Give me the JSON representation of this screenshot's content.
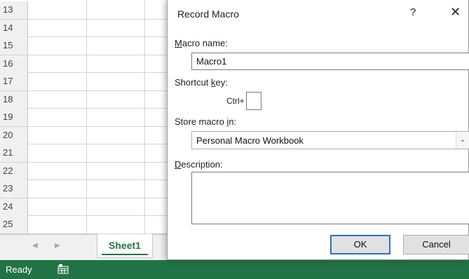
{
  "sheet": {
    "row_numbers": [
      "13",
      "14",
      "15",
      "16",
      "17",
      "18",
      "19",
      "20",
      "21",
      "22",
      "23",
      "24",
      "25"
    ],
    "tab_label": "Sheet1",
    "nav_prev": "◀",
    "nav_next": "▶"
  },
  "status_bar": {
    "ready_label": "Ready",
    "icon": "macro-record-icon"
  },
  "dialog": {
    "title": "Record Macro",
    "help_label": "?",
    "close_label": "✕",
    "macro_name": {
      "label_accel": "M",
      "label_rest": "acro name:",
      "value": "Macro1"
    },
    "shortcut_key": {
      "label_pre": "Shortcut ",
      "label_accel": "k",
      "label_post": "ey:",
      "ctrl_label": "Ctrl+",
      "value": ""
    },
    "store_macro": {
      "label_pre": "Store macro ",
      "label_accel": "i",
      "label_post": "n:",
      "selected": "Personal Macro Workbook"
    },
    "description": {
      "label_accel": "D",
      "label_rest": "escription:",
      "value": ""
    },
    "buttons": {
      "ok": "OK",
      "cancel": "Cancel"
    }
  },
  "colors": {
    "excel_green": "#217346",
    "ok_border": "#2f6fc7"
  }
}
